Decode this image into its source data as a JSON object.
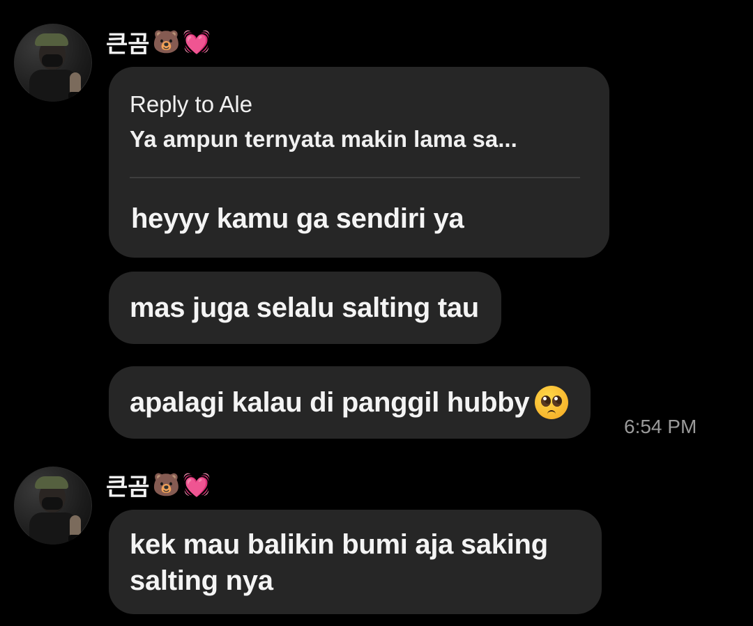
{
  "groups": [
    {
      "sender": {
        "name": "큰곰",
        "emoji": [
          "🐻",
          "💓"
        ]
      },
      "messages": [
        {
          "reply_label": "Reply to Ale",
          "reply_quote": "Ya ampun ternyata makin lama sa...",
          "text": "heyyy kamu ga sendiri ya"
        },
        {
          "text": "mas juga selalu salting tau"
        },
        {
          "text": "apalagi kalau di panggil hubby",
          "emoji_icon": "pleading-face-icon",
          "time": "6:54 PM"
        }
      ]
    },
    {
      "sender": {
        "name": "큰곰",
        "emoji": [
          "🐻",
          "💓"
        ]
      },
      "messages": [
        {
          "text": "kek mau balikin bumi aja saking salting nya"
        }
      ]
    }
  ],
  "colors": {
    "background": "#000000",
    "bubble": "#262626",
    "text": "#f4f4f4",
    "timestamp": "#9a9a9a"
  }
}
